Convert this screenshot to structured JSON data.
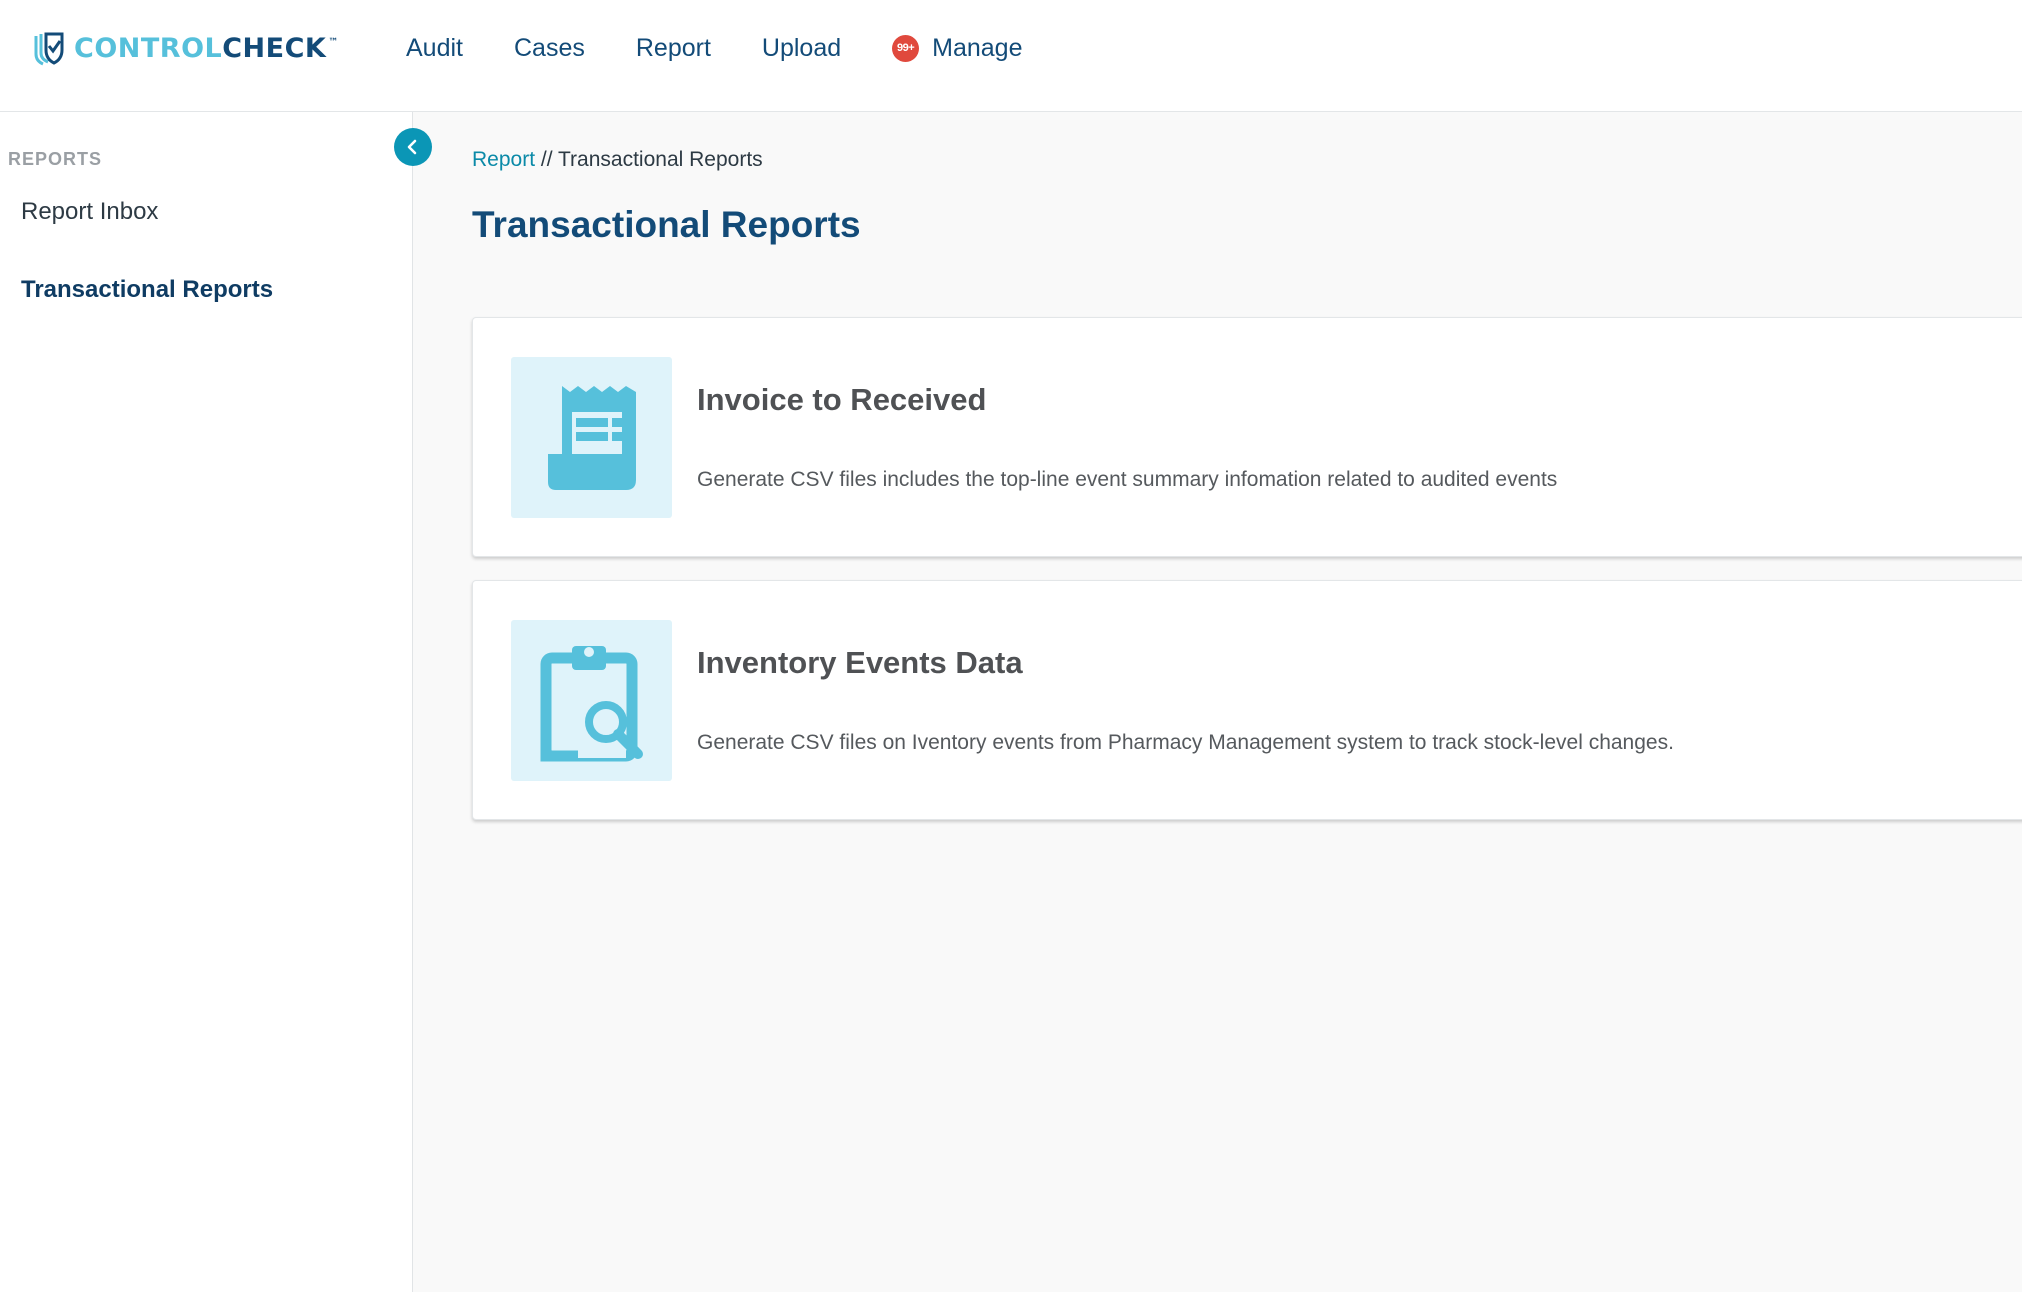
{
  "header": {
    "logo": {
      "text_part1": "CONTROL",
      "text_part2": "CHECK",
      "trademark": "™"
    },
    "nav": [
      {
        "label": "Audit"
      },
      {
        "label": "Cases"
      },
      {
        "label": "Report"
      },
      {
        "label": "Upload"
      },
      {
        "label": "Manage",
        "badge": "99+"
      }
    ]
  },
  "sidebar": {
    "heading": "REPORTS",
    "items": [
      {
        "label": "Report Inbox",
        "active": false
      },
      {
        "label": "Transactional Reports",
        "active": true
      }
    ],
    "collapse_icon": "chevron-left-icon"
  },
  "main": {
    "breadcrumb": {
      "link": "Report",
      "separator": " // ",
      "current": "Transactional Reports"
    },
    "title": "Transactional Reports",
    "cards": [
      {
        "icon": "receipt-icon",
        "title": "Invoice to Received",
        "description": "Generate CSV files includes the top-line event summary infomation related to audited events"
      },
      {
        "icon": "clipboard-search-icon",
        "title": "Inventory Events Data",
        "description": "Generate CSV files on Iventory events from Pharmacy Management system to track stock-level changes."
      }
    ]
  },
  "colors": {
    "brand_dark": "#134b78",
    "brand_light": "#56c0db",
    "accent": "#0b96b6",
    "badge": "#e0493d",
    "icon_bg": "#dff3fa"
  }
}
